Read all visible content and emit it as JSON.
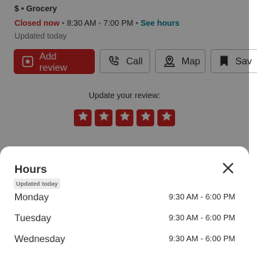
{
  "business": {
    "category": "$ • Grocery",
    "status_closed": "Closed now",
    "status_sep": " • ",
    "status_hours": "8:30 AM - 7:00 PM",
    "status_sep2": " • ",
    "see_hours": "See hours",
    "updated": "Updated today"
  },
  "actions": {
    "add_review": "Add review",
    "call": "Call",
    "map": "Map",
    "save": "Sav"
  },
  "review": {
    "prompt": "Update your review:",
    "rating": 5
  },
  "hours_sheet": {
    "title": "Hours",
    "badge": "Updated today",
    "rows": [
      {
        "day": "Monday",
        "time": "9:30 AM - 6:00 PM"
      },
      {
        "day": "Tuesday",
        "time": "9:30 AM - 6:00 PM"
      },
      {
        "day": "Wednesday",
        "time": "9:30 AM - 6:00 PM"
      }
    ]
  },
  "colors": {
    "brand_red": "#d32323",
    "link_teal": "#027a97",
    "text": "#2d2e2f",
    "muted": "#6e7072"
  },
  "icons": [
    "star-icon",
    "phone-icon",
    "map-pin-icon",
    "bookmark-icon",
    "close-icon"
  ]
}
